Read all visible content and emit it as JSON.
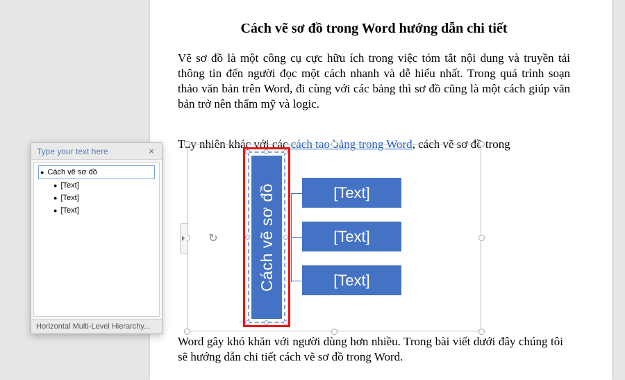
{
  "document": {
    "title": "Cách vẽ sơ đồ trong Word hướng dẫn chi tiết",
    "para1": "Vẽ sơ đồ là một công cụ cực hữu ích trong việc tóm tắt nội dung và truyền tải thông tin đến người đọc một cách nhanh và dễ hiểu nhất. Trong quá trình soạn thảo văn bản trên Word, đi cùng với các bảng thì sơ đồ cũng là một cách giúp văn bản trở nên thẩm mỹ và logic.",
    "para2_pre": "Tuy nhiên khác với các ",
    "para2_link": "cách tạo bảng trong Word",
    "para2_post": ", cách vẽ sơ đồ trong",
    "para3": "Word gây khó khăn với người dùng hơn nhiều. Trong bài viết dưới đây chúng tôi sẽ hướng dẫn chi tiết cách vẽ sơ đồ trong Word."
  },
  "smartart": {
    "main_label": "Cách vẽ sơ đồ",
    "children": [
      "[Text]",
      "[Text]",
      "[Text]"
    ]
  },
  "text_pane": {
    "header": "Type your text here",
    "close": "×",
    "items": [
      {
        "label": "Cách vẽ sơ đồ",
        "indent": false,
        "selected": true
      },
      {
        "label": "[Text]",
        "indent": true,
        "selected": false
      },
      {
        "label": "[Text]",
        "indent": true,
        "selected": false
      },
      {
        "label": "[Text]",
        "indent": true,
        "selected": false
      }
    ],
    "footer": "Horizontal Multi-Level Hierarchy..."
  }
}
